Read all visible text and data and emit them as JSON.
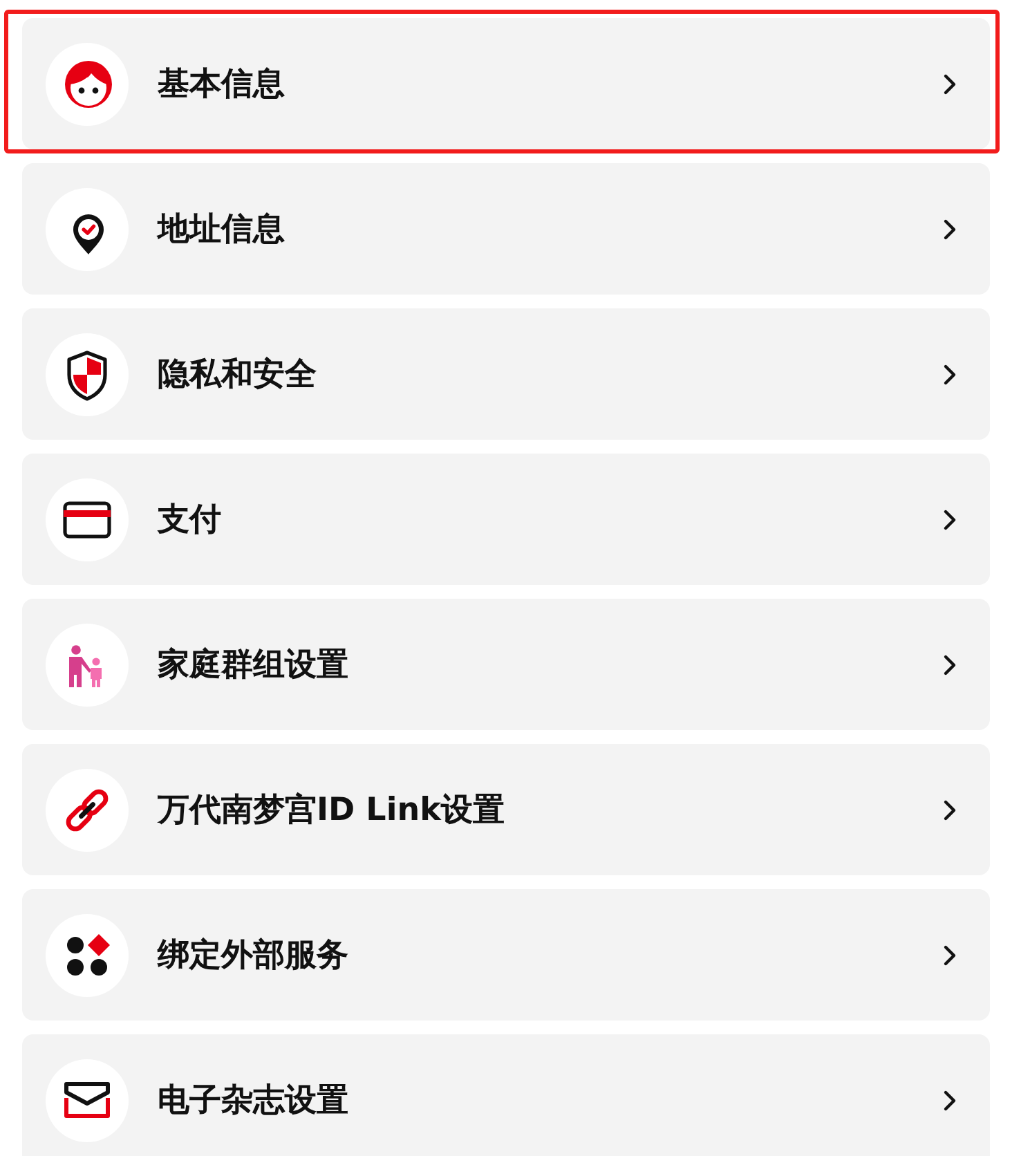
{
  "items": [
    {
      "label": "基本信息",
      "selected": true
    },
    {
      "label": "地址信息",
      "selected": false
    },
    {
      "label": "隐私和安全",
      "selected": false
    },
    {
      "label": "支付",
      "selected": false
    },
    {
      "label": "家庭群组设置",
      "selected": false
    },
    {
      "label": "万代南梦宫ID Link设置",
      "selected": false
    },
    {
      "label": "绑定外部服务",
      "selected": false
    },
    {
      "label": "电子杂志设置",
      "selected": false
    }
  ]
}
